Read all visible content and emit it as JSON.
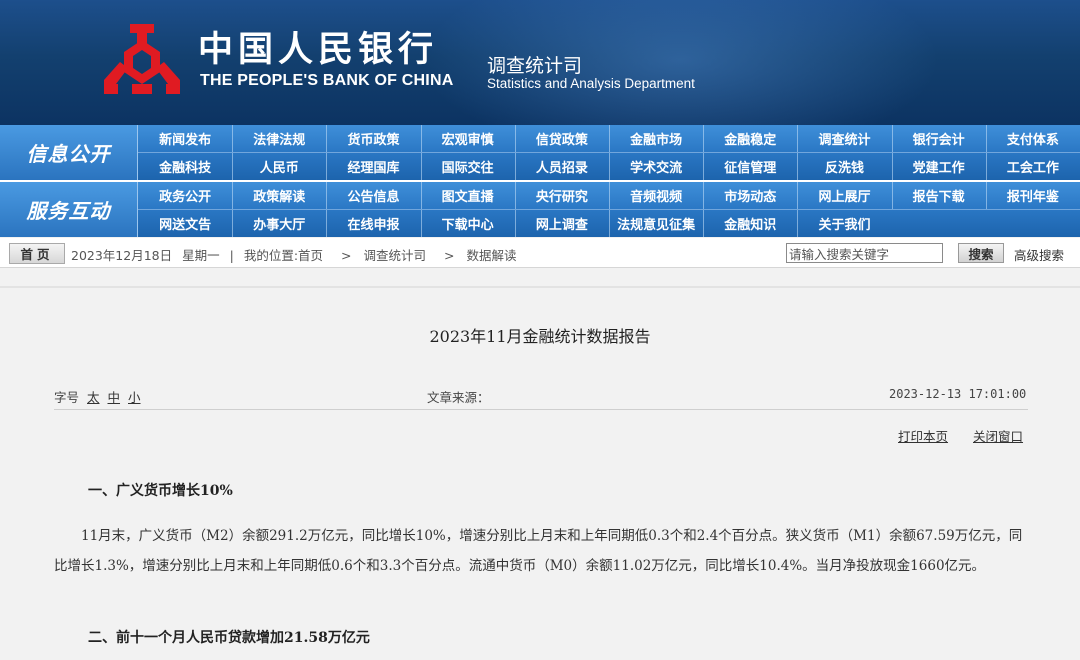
{
  "banner": {
    "bank_name_cn": "中国人民银行",
    "bank_name_en": "THE PEOPLE'S BANK OF CHINA",
    "dept_cn": "调查统计司",
    "dept_en": "Statistics and Analysis Department",
    "logo_icon": "pboc-emblem-icon",
    "colors": {
      "banner_bg": "#13406f",
      "logo_red": "#e01b22"
    }
  },
  "nav": {
    "group1_label": "信息公开",
    "group2_label": "服务互动",
    "rows": [
      [
        "新闻发布",
        "法律法规",
        "货币政策",
        "宏观审慎",
        "信贷政策",
        "金融市场",
        "金融稳定",
        "调查统计",
        "银行会计",
        "支付体系"
      ],
      [
        "金融科技",
        "人民币",
        "经理国库",
        "国际交往",
        "人员招录",
        "学术交流",
        "征信管理",
        "反洗钱",
        "党建工作",
        "工会工作"
      ],
      [
        "政务公开",
        "政策解读",
        "公告信息",
        "图文直播",
        "央行研究",
        "音频视频",
        "市场动态",
        "网上展厅",
        "报告下载",
        "报刊年鉴"
      ],
      [
        "网送文告",
        "办事大厅",
        "在线申报",
        "下载中心",
        "网上调查",
        "法规意见征集",
        "金融知识",
        "关于我们"
      ]
    ],
    "colors": {
      "nav_bg": "#2a77c4"
    }
  },
  "crumbbar": {
    "home_label": "首页",
    "date": "2023年12月18日",
    "weekday": "星期一",
    "divider": "|",
    "location_label": "我的位置:首页",
    "crumbs": [
      "调查统计司",
      "数据解读"
    ],
    "arrow": ">",
    "search_placeholder": "请输入搜索关键字",
    "search_button": "搜索",
    "advanced_search": "高级搜索"
  },
  "article": {
    "title": "2023年11月金融统计数据报告",
    "font_size_label": "字号",
    "font_sizes": [
      "太",
      "中",
      "小"
    ],
    "source_label": "文章来源：",
    "date": "2023-12-13 17:01:00",
    "print_label": "打印本页",
    "close_label": "关闭窗口",
    "section1_title": "一、广义货币增长10%",
    "section1_body": "11月末，广义货币（M2）余额291.2万亿元，同比增长10%，增速分别比上月末和上年同期低0.3个和2.4个百分点。狭义货币（M1）余额67.59万亿元，同比增长1.3%，增速分别比上月末和上年同期低0.6个和3.3个百分点。流通中货币（M0）余额11.02万亿元，同比增长10.4%。当月净投放现金1660亿元。",
    "section2_title": "二、前十一个月人民币贷款增加21.58万亿元"
  }
}
